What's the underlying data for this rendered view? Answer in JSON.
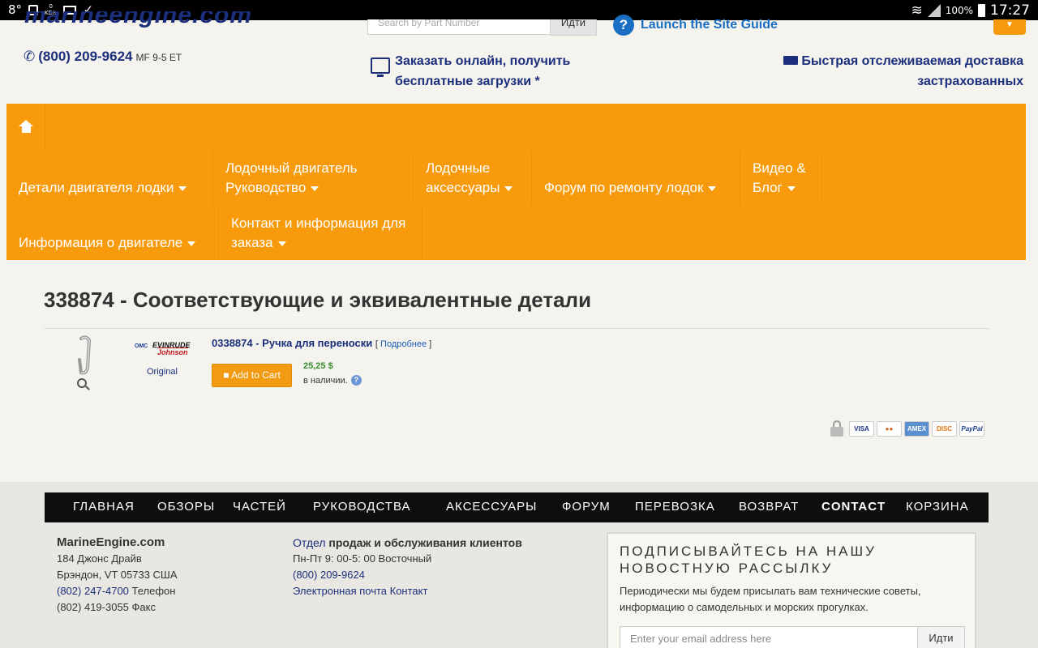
{
  "status_bar": {
    "temp": "8°",
    "net": "0",
    "net_unit": "KB/s",
    "battery": "100%",
    "time": "17:27"
  },
  "header": {
    "logo_text": "marineengine.com",
    "search_placeholder": "Search by Part Number",
    "search_button": "Идти",
    "guide_icon": "?",
    "guide_label": "Launch the Site Guide",
    "phone": "(800) 209-9624",
    "phone_hours": "MF 9-5 ET",
    "order_text": "Заказать онлайн, получить бесплатные загрузки *",
    "shipping_text": "Быстрая отслеживаемая доставка застрахованных"
  },
  "nav": {
    "items": [
      {
        "label": "Детали двигателя лодки"
      },
      {
        "label": "Лодочный двигатель Руководство"
      },
      {
        "label": "Лодочные аксессуары"
      },
      {
        "label": "Форум по ремонту лодок"
      },
      {
        "label": "Видео & Блог"
      },
      {
        "label": "Информация о двигателе"
      },
      {
        "label": "Контакт и информация для заказа"
      }
    ]
  },
  "content": {
    "title": "338874 - Соответствующие и эквивалентные детали",
    "part": {
      "brand_omc": "OMC",
      "brand_evinrude": "EVINRUDE",
      "brand_johnson": "Johnson",
      "original_label": "Original",
      "name": "0338874 - Ручка для переноски",
      "more_open": "[ ",
      "more_link": "Подробнее",
      "more_close": " ]",
      "add_to_cart": "Add to Cart",
      "price": "25,25 $",
      "stock": "в наличии.",
      "help_icon": "?"
    },
    "payments": [
      "VISA",
      "MC",
      "AMEX",
      "DISCOVER",
      "PayPal"
    ]
  },
  "footer": {
    "nav": [
      "ГЛАВНАЯ",
      "ОБЗОРЫ",
      "ЧАСТЕЙ",
      "РУКОВОДСТВА",
      "АКСЕССУАРЫ",
      "ФОРУМ",
      "ПЕРЕВОЗКА",
      "ВОЗВРАТ",
      "CONTACT",
      "КОРЗИНА"
    ],
    "company": "MarineEngine.com",
    "address1": "184 Джонс Драйв",
    "address2": "Брэндон, VT 05733 США",
    "phone": "(802) 247-4700",
    "phone_label": "Телефон",
    "fax": "(802) 419-3055 Факс",
    "sales_pre": "Отдел",
    "sales_head": "продаж и обслуживания клиентов",
    "sales_hours": "Пн-Пт 9: 00-5: 00 Восточный",
    "sales_phone": "(800) 209-9624",
    "sales_email": "Электронная почта Контакт",
    "newsletter_title": "ПОДПИСЫВАЙТЕСЬ НА НАШУ НОВОСТНУЮ РАССЫЛКУ",
    "newsletter_desc": "Периодически мы будем присылать вам технические советы, информацию о самодельных и морских прогулках.",
    "newsletter_placeholder": "Enter your email address here",
    "newsletter_button": "Идти"
  },
  "colors": {
    "accent": "#f79b0c",
    "link": "#1b2f7d",
    "price": "#3a8c2e"
  }
}
